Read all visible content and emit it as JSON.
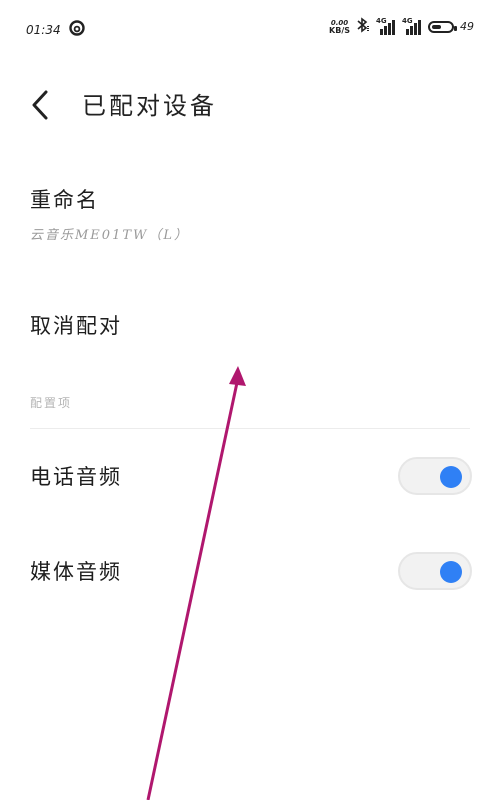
{
  "status_bar": {
    "time": "01:34",
    "app_icon": "netease-music-icon",
    "net_speed_value": "0.00",
    "net_speed_unit": "KB/S",
    "bluetooth_icon": "bluetooth-icon",
    "sim1_tag": "4G",
    "sim2_tag": "4G",
    "battery_level": "49"
  },
  "header": {
    "back_icon": "chevron-left-icon",
    "title": "已配对设备"
  },
  "rename": {
    "label": "重命名",
    "device_name": "云音乐ME01TW（L）"
  },
  "unpair": {
    "label": "取消配对"
  },
  "config": {
    "section_label": "配置项",
    "items": [
      {
        "label": "电话音频",
        "enabled": true
      },
      {
        "label": "媒体音频",
        "enabled": true
      }
    ]
  },
  "colors": {
    "toggle_on": "#2f80f5",
    "annotation_arrow": "#b0176e"
  }
}
